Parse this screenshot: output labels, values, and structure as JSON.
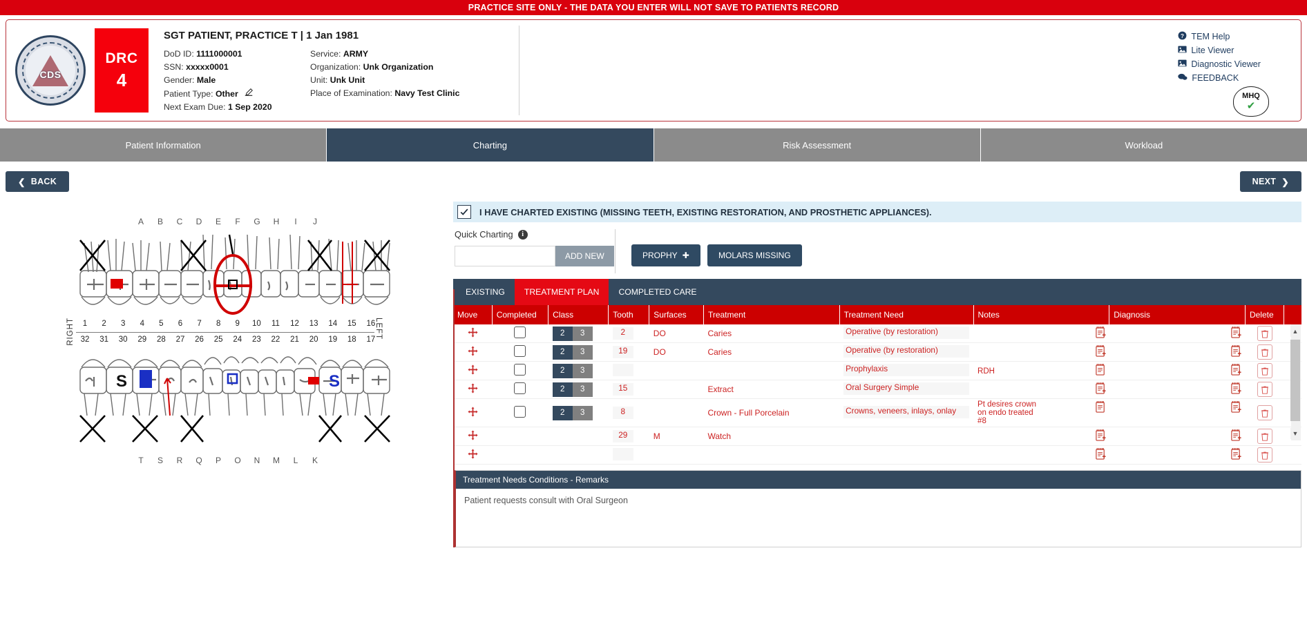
{
  "banner": {
    "text": "PRACTICE SITE ONLY - THE DATA YOU ENTER WILL NOT SAVE TO PATIENTS RECORD"
  },
  "header": {
    "seal_text": "CDS",
    "drc_label": "DRC",
    "drc_value": "4",
    "patient_name": "SGT PATIENT, PRACTICE T | 1 Jan 1981",
    "fields_left": [
      {
        "label": "DoD ID:",
        "value": "1111000001"
      },
      {
        "label": "SSN:",
        "value": "xxxxx0001"
      },
      {
        "label": "Gender:",
        "value": "Male"
      },
      {
        "label": "Patient Type:",
        "value": "Other"
      },
      {
        "label": "Next Exam Due:",
        "value": "1 Sep 2020"
      }
    ],
    "fields_right": [
      {
        "label": "Service:",
        "value": "ARMY"
      },
      {
        "label": "Organization:",
        "value": "Unk Organization"
      },
      {
        "label": "Unit:",
        "value": "Unk Unit"
      },
      {
        "label": "Place of Examination:",
        "value": "Navy Test Clinic"
      }
    ],
    "links": [
      {
        "icon": "help-circle-icon",
        "label": "TEM Help"
      },
      {
        "icon": "image-icon",
        "label": "Lite Viewer"
      },
      {
        "icon": "image-icon",
        "label": "Diagnostic Viewer"
      },
      {
        "icon": "comment-icon",
        "label": "FEEDBACK"
      }
    ],
    "mhq_text": "MHQ"
  },
  "nav_tabs": [
    {
      "label": "Patient Information",
      "active": false
    },
    {
      "label": "Charting",
      "active": true
    },
    {
      "label": "Risk Assessment",
      "active": false
    },
    {
      "label": "Workload",
      "active": false
    }
  ],
  "nav_buttons": {
    "back": "BACK",
    "next": "NEXT"
  },
  "odontogram": {
    "letters_top": [
      "A",
      "B",
      "C",
      "D",
      "E",
      "F",
      "G",
      "H",
      "I",
      "J"
    ],
    "letters_bottom": [
      "T",
      "S",
      "R",
      "Q",
      "P",
      "O",
      "N",
      "M",
      "L",
      "K"
    ],
    "numbers_upper": [
      "1",
      "2",
      "3",
      "4",
      "5",
      "6",
      "7",
      "8",
      "9",
      "10",
      "11",
      "12",
      "13",
      "14",
      "15",
      "16"
    ],
    "numbers_lower": [
      "32",
      "31",
      "30",
      "29",
      "28",
      "27",
      "26",
      "25",
      "24",
      "23",
      "22",
      "21",
      "20",
      "19",
      "18",
      "17"
    ],
    "side_right": "RIGHT",
    "side_left": "LEFT",
    "markings": {
      "missing_x_upper": [
        1,
        5,
        12,
        16
      ],
      "red_circle_tooth": "8",
      "red_bridge_tooth": "15",
      "red_filling_tooth": "2",
      "lower_s_teeth": [
        "31",
        "18"
      ],
      "lower_blue_crown_tooth": "30",
      "lower_red_filling_tooth": "19",
      "missing_x_lower": [
        32,
        30,
        28,
        19,
        17
      ]
    }
  },
  "charted_checkbox": {
    "checked": true,
    "label": "I HAVE CHARTED EXISTING (MISSING TEETH, EXISTING RESTORATION, AND PROSTHETIC APPLIANCES)."
  },
  "quick_charting": {
    "label": "Quick Charting",
    "info_icon": "info-icon",
    "input_value": "",
    "input_placeholder": "",
    "add_new": "ADD NEW",
    "prophy": "PROPHY",
    "molars_missing": "MOLARS MISSING"
  },
  "sub_tabs": [
    {
      "label": "EXISTING",
      "active": false
    },
    {
      "label": "TREATMENT PLAN",
      "active": true
    },
    {
      "label": "COMPLETED CARE",
      "active": false
    }
  ],
  "table": {
    "columns": [
      "Move",
      "Completed",
      "Class",
      "Tooth",
      "Surfaces",
      "Treatment",
      "Treatment Need",
      "Notes",
      "Diagnosis",
      "Delete"
    ],
    "class_options": [
      "2",
      "3"
    ],
    "rows": [
      {
        "move": "move-icon",
        "completed": true,
        "class_a": "2",
        "class_b": "3",
        "tooth": "2",
        "surfaces": "DO",
        "treatment": "Caries",
        "need": "Operative (by restoration)",
        "notes": "",
        "has_notes_icon": true,
        "has_diag_icon": true,
        "has_delete": true
      },
      {
        "move": "move-icon",
        "completed": true,
        "class_a": "2",
        "class_b": "3",
        "tooth": "19",
        "surfaces": "DO",
        "treatment": "Caries",
        "need": "Operative (by restoration)",
        "notes": "",
        "has_notes_icon": true,
        "has_diag_icon": true,
        "has_delete": true
      },
      {
        "move": "move-icon",
        "completed": true,
        "class_a": "2",
        "class_b": "3",
        "tooth": "",
        "surfaces": "",
        "treatment": "",
        "need": "Prophylaxis",
        "notes": "RDH",
        "has_notes_icon": true,
        "has_diag_icon": true,
        "has_delete": true
      },
      {
        "move": "move-icon",
        "completed": true,
        "class_a": "2",
        "class_b": "3",
        "tooth": "15",
        "surfaces": "",
        "treatment": "Extract",
        "need": "Oral Surgery Simple",
        "notes": "",
        "has_notes_icon": true,
        "has_diag_icon": true,
        "has_delete": true
      },
      {
        "move": "move-icon",
        "completed": true,
        "class_a": "2",
        "class_b": "3",
        "tooth": "8",
        "surfaces": "",
        "treatment": "Crown - Full Porcelain",
        "need": "Crowns, veneers, inlays, onlay",
        "notes": "Pt desires crown on endo treated #8",
        "has_notes_icon": true,
        "has_diag_icon": true,
        "has_delete": true
      },
      {
        "move": "move-icon",
        "completed": false,
        "class_a": "",
        "class_b": "",
        "tooth": "29",
        "surfaces": "M",
        "treatment": "Watch",
        "need": "",
        "notes": "",
        "has_notes_icon": true,
        "has_diag_icon": true,
        "has_delete": true
      },
      {
        "move": "move-icon",
        "completed": false,
        "class_a": "",
        "class_b": "",
        "tooth": "",
        "surfaces": "",
        "treatment": "",
        "need": "",
        "notes": "",
        "has_notes_icon": true,
        "has_diag_icon": true,
        "has_delete": true
      }
    ]
  },
  "remarks": {
    "title": "Treatment Needs Conditions - Remarks",
    "text": "Patient requests consult with Oral Surgeon"
  },
  "colors": {
    "banner_red": "#d9000d",
    "accent_red": "#e50914",
    "table_header_red": "#cc0000",
    "navy": "#34495e",
    "tab_gray": "#8b8b8b",
    "info_blue": "#ddeef7"
  }
}
